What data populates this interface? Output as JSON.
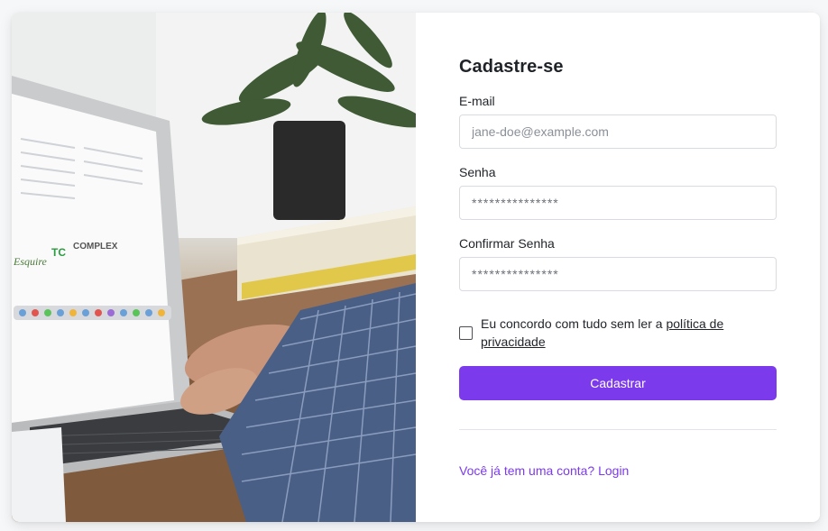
{
  "form": {
    "title": "Cadastre-se",
    "email": {
      "label": "E-mail",
      "placeholder": "jane-doe@example.com",
      "value": ""
    },
    "password": {
      "label": "Senha",
      "placeholder": "***************",
      "value": ""
    },
    "confirm_password": {
      "label": "Confirmar Senha",
      "placeholder": "***************",
      "value": ""
    },
    "agree": {
      "text": "Eu concordo com tudo sem ler a ",
      "link_text": "política de privacidade",
      "checked": false
    },
    "submit_label": "Cadastrar",
    "login_link": "Você já tem uma conta? Login"
  },
  "illustration": {
    "subject": "laptop-desk-photo",
    "screen_logos": [
      "Esquire",
      "TC",
      "COMPLEX"
    ]
  },
  "theme": {
    "accent": "#7c3aed",
    "background": "#f6f7f9",
    "card": "#ffffff",
    "border": "#d8dbe0"
  }
}
